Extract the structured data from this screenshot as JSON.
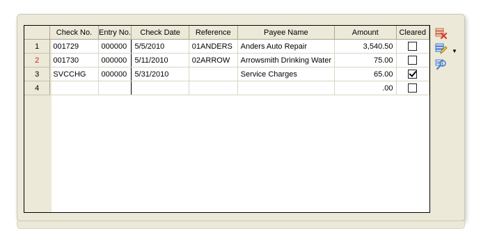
{
  "grid": {
    "columns": [
      "Check No.",
      "Entry No.",
      "Check Date",
      "Reference",
      "Payee Name",
      "Amount",
      "Cleared"
    ],
    "rows": [
      {
        "row_no": "1",
        "check_no": "001729",
        "entry_no": "000000",
        "check_date": "5/5/2010",
        "reference": "01ANDERS",
        "payee": "Anders Auto Repair",
        "amount": "3,540.50",
        "cleared": false
      },
      {
        "row_no": "2",
        "check_no": "001730",
        "entry_no": "000000",
        "check_date": "5/11/2010",
        "reference": "02ARROW",
        "payee": "Arrowsmith Drinking Water",
        "amount": "75.00",
        "cleared": false
      },
      {
        "row_no": "3",
        "check_no": "SVCCHG",
        "entry_no": "000000",
        "check_date": "5/31/2010",
        "reference": "",
        "payee": "Service Charges",
        "amount": "65.00",
        "cleared": true
      },
      {
        "row_no": "4",
        "check_no": "",
        "entry_no": "",
        "check_date": "",
        "reference": "",
        "payee": "",
        "amount": ".00",
        "cleared": false
      }
    ]
  },
  "toolbar": {
    "icons": [
      "delete-rows-icon",
      "edit-rows-icon",
      "find-icon"
    ],
    "colors": {
      "delete": "#d23a2a",
      "edit": "#3a6fc8",
      "find": "#4a7ec9"
    }
  }
}
